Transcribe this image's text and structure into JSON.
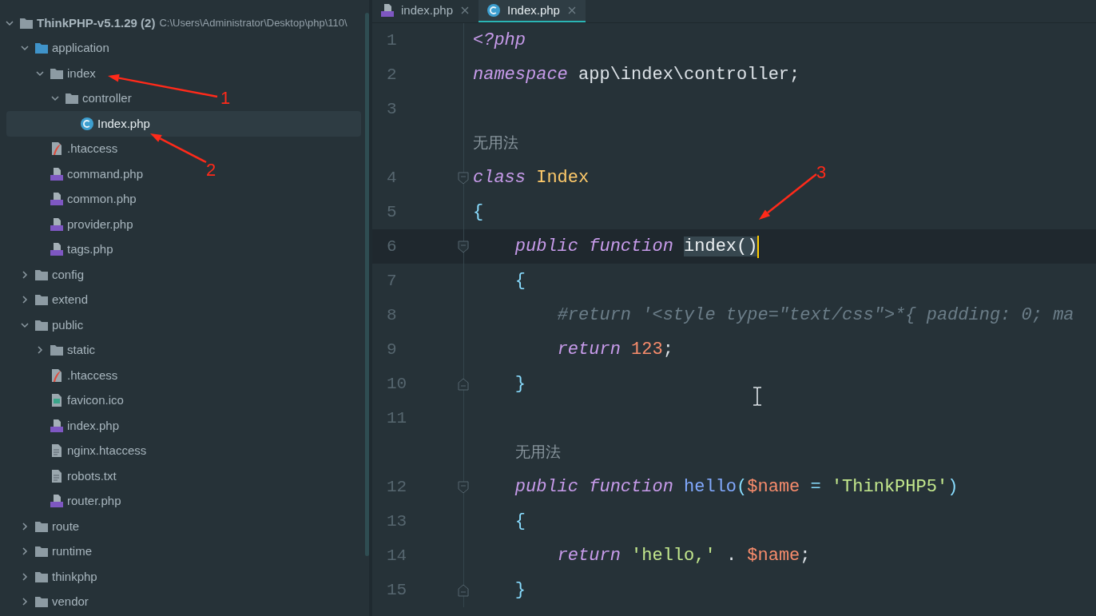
{
  "project_tree": {
    "root": {
      "name": "ThinkPHP-v5.1.29 (2)",
      "path": "C:\\Users\\Administrator\\Desktop\\php\\110\\",
      "kind": "folder",
      "expanded": true,
      "selected": false,
      "children": [
        {
          "name": "application",
          "kind": "source_folder",
          "expanded": true,
          "selected": false,
          "children": [
            {
              "name": "index",
              "kind": "folder",
              "expanded": true,
              "selected": false,
              "children": [
                {
                  "name": "controller",
                  "kind": "folder",
                  "expanded": true,
                  "selected": false,
                  "children": [
                    {
                      "name": "Index.php",
                      "kind": "class_file",
                      "selected": true
                    }
                  ]
                }
              ]
            },
            {
              "name": ".htaccess",
              "kind": "htaccess_file",
              "selected": false
            },
            {
              "name": "command.php",
              "kind": "php_file",
              "selected": false
            },
            {
              "name": "common.php",
              "kind": "php_file",
              "selected": false
            },
            {
              "name": "provider.php",
              "kind": "php_file",
              "selected": false
            },
            {
              "name": "tags.php",
              "kind": "php_file",
              "selected": false
            }
          ]
        },
        {
          "name": "config",
          "kind": "folder",
          "expanded": false,
          "selected": false
        },
        {
          "name": "extend",
          "kind": "folder",
          "expanded": false,
          "selected": false
        },
        {
          "name": "public",
          "kind": "folder",
          "expanded": true,
          "selected": false,
          "children": [
            {
              "name": "static",
              "kind": "folder",
              "expanded": false,
              "selected": false
            },
            {
              "name": ".htaccess",
              "kind": "htaccess_file",
              "selected": false
            },
            {
              "name": "favicon.ico",
              "kind": "image_file",
              "selected": false
            },
            {
              "name": "index.php",
              "kind": "php_file",
              "selected": false
            },
            {
              "name": "nginx.htaccess",
              "kind": "text_file",
              "selected": false
            },
            {
              "name": "robots.txt",
              "kind": "text_file",
              "selected": false
            },
            {
              "name": "router.php",
              "kind": "php_file",
              "selected": false
            }
          ]
        },
        {
          "name": "route",
          "kind": "folder",
          "expanded": false,
          "selected": false
        },
        {
          "name": "runtime",
          "kind": "folder",
          "expanded": false,
          "selected": false
        },
        {
          "name": "thinkphp",
          "kind": "folder",
          "expanded": false,
          "selected": false
        },
        {
          "name": "vendor",
          "kind": "folder",
          "expanded": false,
          "selected": false
        }
      ]
    }
  },
  "tabs": [
    {
      "label": "index.php",
      "kind": "php_file",
      "selected": false
    },
    {
      "label": "Index.php",
      "kind": "class_file",
      "selected": true
    }
  ],
  "code": {
    "lines": [
      {
        "kind": "code",
        "number": "1",
        "current": false,
        "fold_start": false,
        "fold_end": false,
        "tokens": [
          {
            "t": "<?php",
            "kind": "keyword"
          }
        ]
      },
      {
        "kind": "code",
        "number": "2",
        "current": false,
        "fold_start": false,
        "fold_end": false,
        "tokens": [
          {
            "t": "namespace",
            "kind": "keyword"
          },
          {
            "t": " app\\index\\controller;",
            "kind": "plain"
          }
        ]
      },
      {
        "kind": "code",
        "number": "3",
        "current": false,
        "fold_start": false,
        "fold_end": false
      },
      {
        "kind": "hint",
        "text": "无用法"
      },
      {
        "kind": "code",
        "number": "4",
        "current": false,
        "fold_start": true,
        "fold_end": false,
        "tokens": [
          {
            "t": "class ",
            "kind": "keyword"
          },
          {
            "t": "Index",
            "kind": "class"
          }
        ]
      },
      {
        "kind": "code",
        "number": "5",
        "current": false,
        "fold_start": false,
        "fold_end": false,
        "tokens": [
          {
            "t": "{",
            "kind": "brace"
          }
        ]
      },
      {
        "kind": "code",
        "number": "6",
        "current": true,
        "fold_start": true,
        "fold_end": false,
        "tokens": [
          {
            "t": "    public function ",
            "kind": "keyword"
          },
          {
            "t": "index()",
            "kind": "selection"
          }
        ]
      },
      {
        "kind": "code",
        "number": "7",
        "current": false,
        "fold_start": false,
        "fold_end": false,
        "tokens": [
          {
            "t": "    {",
            "kind": "brace"
          }
        ]
      },
      {
        "kind": "code",
        "number": "8",
        "current": false,
        "fold_start": false,
        "fold_end": false,
        "tokens": [
          {
            "t": "        #return '<style type=\"text/css\">*{ padding: 0; ma",
            "kind": "comment"
          }
        ]
      },
      {
        "kind": "code",
        "number": "9",
        "current": false,
        "fold_start": false,
        "fold_end": false,
        "tokens": [
          {
            "t": "        return ",
            "kind": "keyword"
          },
          {
            "t": "123",
            "kind": "number"
          },
          {
            "t": ";",
            "kind": "plain"
          }
        ]
      },
      {
        "kind": "code",
        "number": "10",
        "current": false,
        "fold_start": false,
        "fold_end": true,
        "tokens": [
          {
            "t": "    }",
            "kind": "brace"
          }
        ]
      },
      {
        "kind": "code",
        "number": "11",
        "current": false,
        "fold_start": false,
        "fold_end": false
      },
      {
        "kind": "hint",
        "text": "无用法"
      },
      {
        "kind": "code",
        "number": "12",
        "current": false,
        "fold_start": true,
        "fold_end": false,
        "tokens": [
          {
            "t": "    public function ",
            "kind": "keyword"
          },
          {
            "t": "hello",
            "kind": "function"
          },
          {
            "t": "(",
            "kind": "brace"
          },
          {
            "t": "$name",
            "kind": "variable"
          },
          {
            "t": " = ",
            "kind": "brace"
          },
          {
            "t": "'ThinkPHP5'",
            "kind": "string"
          },
          {
            "t": ")",
            "kind": "brace"
          }
        ]
      },
      {
        "kind": "code",
        "number": "13",
        "current": false,
        "fold_start": false,
        "fold_end": false,
        "tokens": [
          {
            "t": "    {",
            "kind": "brace"
          }
        ]
      },
      {
        "kind": "code",
        "number": "14",
        "current": false,
        "fold_start": false,
        "fold_end": false,
        "tokens": [
          {
            "t": "        return ",
            "kind": "keyword"
          },
          {
            "t": "'hello,'",
            "kind": "string"
          },
          {
            "t": " . ",
            "kind": "plain"
          },
          {
            "t": "$name",
            "kind": "variable"
          },
          {
            "t": ";",
            "kind": "plain"
          }
        ]
      },
      {
        "kind": "code",
        "number": "15",
        "current": false,
        "fold_start": false,
        "fold_end": true,
        "tokens": [
          {
            "t": "    }",
            "kind": "brace"
          }
        ]
      }
    ]
  },
  "annotations": [
    {
      "label": "1"
    },
    {
      "label": "2"
    },
    {
      "label": "3"
    }
  ]
}
